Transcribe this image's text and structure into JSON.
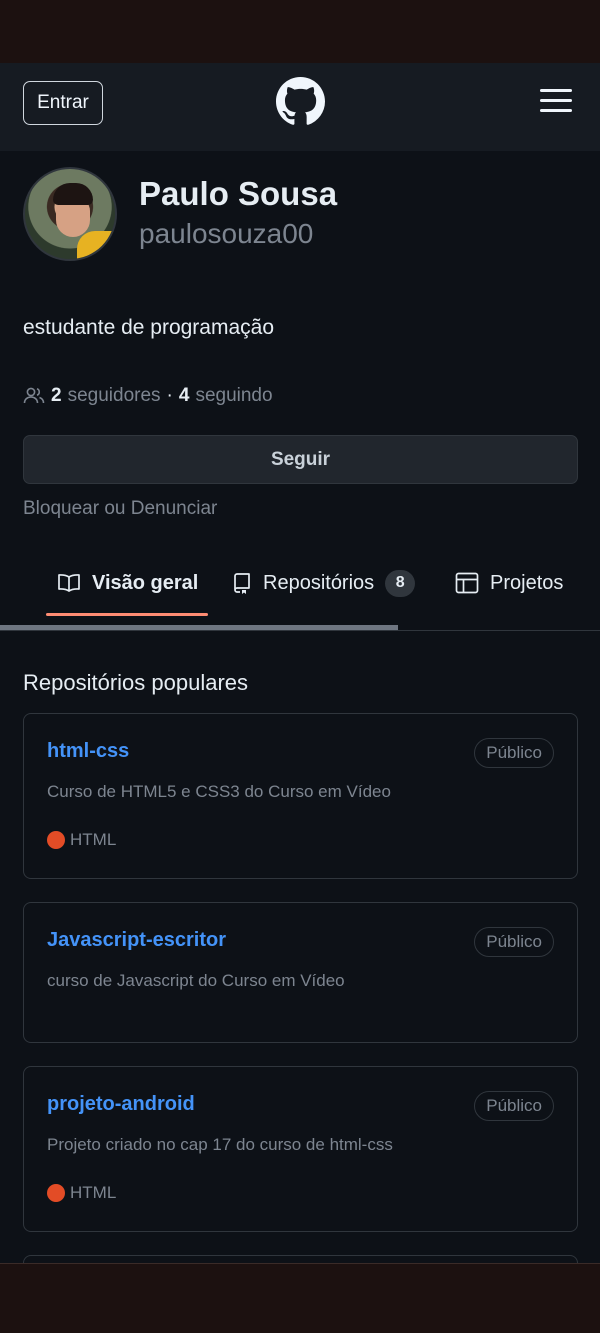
{
  "header": {
    "signin_label": "Entrar",
    "logo_icon": "github-mark-icon",
    "menu_icon": "hamburger-menu-icon"
  },
  "profile": {
    "name": "Paulo Sousa",
    "login": "paulosouza00",
    "bio": "estudante de programação",
    "followers_count": "2",
    "followers_label": "seguidores",
    "separator": "·",
    "following_count": "4",
    "following_label": "seguindo",
    "follow_button": "Seguir",
    "block_link": "Bloquear ou Denunciar"
  },
  "tabs": [
    {
      "label": "Visão geral",
      "icon": "book-icon",
      "active": true
    },
    {
      "label": "Repositórios",
      "icon": "repo-icon",
      "count": "8"
    },
    {
      "label": "Projetos",
      "icon": "table-icon"
    }
  ],
  "popular": {
    "title": "Repositórios populares",
    "repos": [
      {
        "name": "html-css",
        "visibility": "Público",
        "description": "Curso de HTML5 e CSS3 do Curso em Vídeo",
        "language": "HTML",
        "language_color": "#e34c26"
      },
      {
        "name": "Javascript-escritor",
        "visibility": "Público",
        "description": "curso de Javascript do Curso em Vídeo"
      },
      {
        "name": "projeto-android",
        "visibility": "Público",
        "description": "Projeto criado no cap 17 do curso de html-css",
        "language": "HTML",
        "language_color": "#e34c26"
      }
    ]
  },
  "colors": {
    "background": "#0d1117",
    "header": "#161b22",
    "link": "#4493f8",
    "active_tab_underline": "#fd8c73"
  }
}
